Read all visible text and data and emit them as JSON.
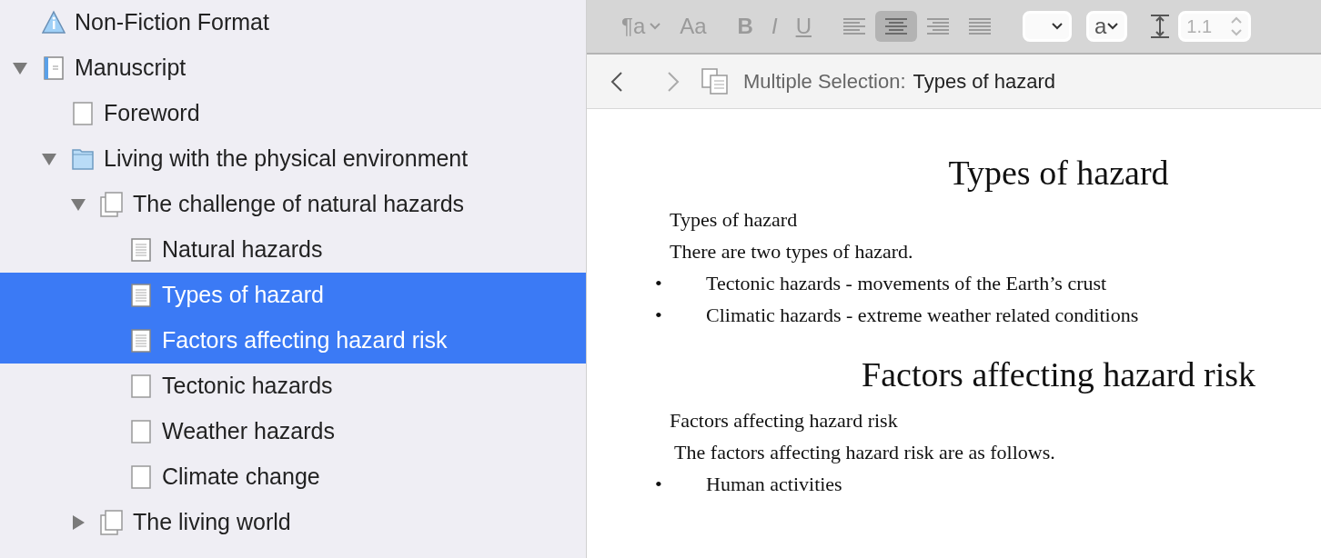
{
  "binder": {
    "items": [
      {
        "label": "Non-Fiction Format",
        "kind": "info",
        "selected": false
      },
      {
        "label": "Manuscript",
        "kind": "manuscript",
        "selected": false,
        "expanded": true,
        "children": [
          {
            "label": "Foreword",
            "kind": "blank",
            "selected": false
          },
          {
            "label": "Living with the physical environment",
            "kind": "folder",
            "selected": false,
            "expanded": true,
            "children": [
              {
                "label": "The challenge of natural hazards",
                "kind": "group",
                "selected": false,
                "expanded": true,
                "children": [
                  {
                    "label": "Natural hazards",
                    "kind": "text",
                    "selected": false
                  },
                  {
                    "label": "Types of hazard",
                    "kind": "text",
                    "selected": true
                  },
                  {
                    "label": "Factors affecting hazard risk",
                    "kind": "text",
                    "selected": true
                  },
                  {
                    "label": "Tectonic hazards",
                    "kind": "blank",
                    "selected": false
                  },
                  {
                    "label": "Weather hazards",
                    "kind": "blank",
                    "selected": false
                  },
                  {
                    "label": "Climate change",
                    "kind": "blank",
                    "selected": false
                  }
                ]
              },
              {
                "label": "The living world",
                "kind": "group",
                "selected": false,
                "expanded": false
              }
            ]
          }
        ]
      }
    ]
  },
  "format_bar": {
    "paragraph_style": "¶a",
    "font_style": "Aa",
    "bold": "B",
    "italic": "I",
    "underline": "U",
    "alignments": [
      {
        "kind": "left",
        "selected": false
      },
      {
        "kind": "center",
        "selected": true
      },
      {
        "kind": "right",
        "selected": false
      },
      {
        "kind": "justify",
        "selected": false
      }
    ],
    "text_color": "a",
    "line_spacing": "1.1"
  },
  "header": {
    "prefix": "Multiple Selection:",
    "title": "Types of hazard"
  },
  "documents": [
    {
      "title": "Types of hazard",
      "blocks": [
        {
          "kind": "plain",
          "text": "Types of hazard"
        },
        {
          "kind": "plain",
          "text": "There are two types of hazard."
        },
        {
          "kind": "bullet",
          "bullet": "•",
          "text": "Tectonic hazards - movements of the Earth’s crust"
        },
        {
          "kind": "bullet",
          "bullet": "•",
          "text": "Climatic hazards - extreme weather related conditions"
        }
      ]
    },
    {
      "title": "Factors affecting hazard risk",
      "blocks": [
        {
          "kind": "plain",
          "text": "Factors affecting hazard risk"
        },
        {
          "kind": "plain",
          "text": " The factors affecting hazard risk are as follows."
        },
        {
          "kind": "bullet",
          "bullet": "•",
          "text": "Human activities"
        }
      ]
    }
  ]
}
